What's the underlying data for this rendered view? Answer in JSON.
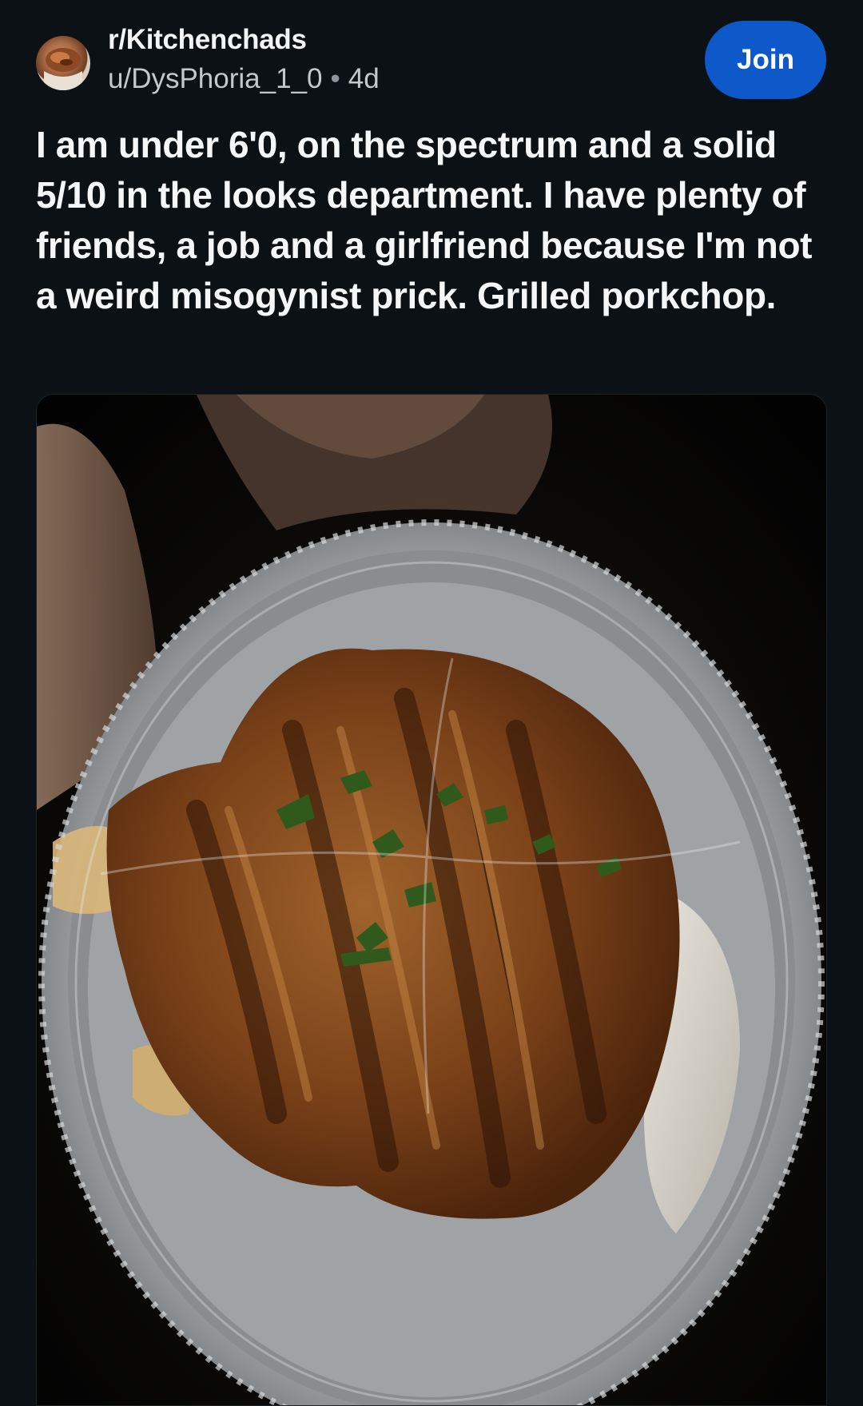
{
  "post": {
    "subreddit": "r/Kitchenchads",
    "author": "u/DysPhoria_1_0",
    "separator": "•",
    "age": "4d",
    "join_label": "Join",
    "title": "I am under 6'0, on the spectrum and a solid 5/10 in the looks department. I have plenty of friends, a job and a girlfriend because I'm not a weird misogynist prick. Grilled porkchop."
  },
  "icons": {
    "avatar": "subreddit-avatar",
    "image": "post-image"
  },
  "colors": {
    "background": "#0b1114",
    "join_button": "#0e59c9",
    "title_text": "#f4f6f7",
    "meta_text": "#c2c9cc"
  }
}
